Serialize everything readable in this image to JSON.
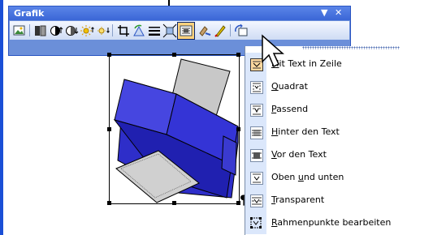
{
  "toolbar": {
    "title": "Grafik",
    "dropdown_glyph": "▼",
    "close_glyph": "✕",
    "buttons": [
      {
        "name": "insert-picture-icon"
      },
      {
        "name": "color-icon"
      },
      {
        "name": "more-contrast-icon"
      },
      {
        "name": "less-contrast-icon"
      },
      {
        "name": "more-brightness-icon"
      },
      {
        "name": "less-brightness-icon"
      },
      {
        "name": "crop-icon"
      },
      {
        "name": "rotate-left-icon"
      },
      {
        "name": "line-style-icon"
      },
      {
        "name": "compress-pictures-icon"
      },
      {
        "name": "text-wrapping-icon"
      },
      {
        "name": "format-picture-icon"
      },
      {
        "name": "set-transparent-color-icon"
      },
      {
        "name": "reset-picture-icon"
      }
    ]
  },
  "paragraph_mark": "¶",
  "wrap_menu": {
    "items": [
      {
        "label": "Mit Text in Zeile",
        "accel": "M",
        "checked": true
      },
      {
        "label": "Quadrat",
        "accel": "Q",
        "checked": false
      },
      {
        "label": "Passend",
        "accel": "P",
        "checked": false
      },
      {
        "label": "Hinter den Text",
        "accel": "H",
        "checked": false
      },
      {
        "label": "Vor den Text",
        "accel": "V",
        "checked": false
      },
      {
        "label": "Oben und unten",
        "accel": "u",
        "checked": false
      },
      {
        "label": "Transparent",
        "accel": "T",
        "checked": false
      },
      {
        "label": "Rahmenpunkte bearbeiten",
        "accel": "R",
        "checked": false
      }
    ]
  },
  "colors": {
    "title_bar": "#3a66d6",
    "menu_gutter": "#dbe7fb",
    "active_button": "#ffd27d",
    "printer_body": "#2e2ec9"
  }
}
